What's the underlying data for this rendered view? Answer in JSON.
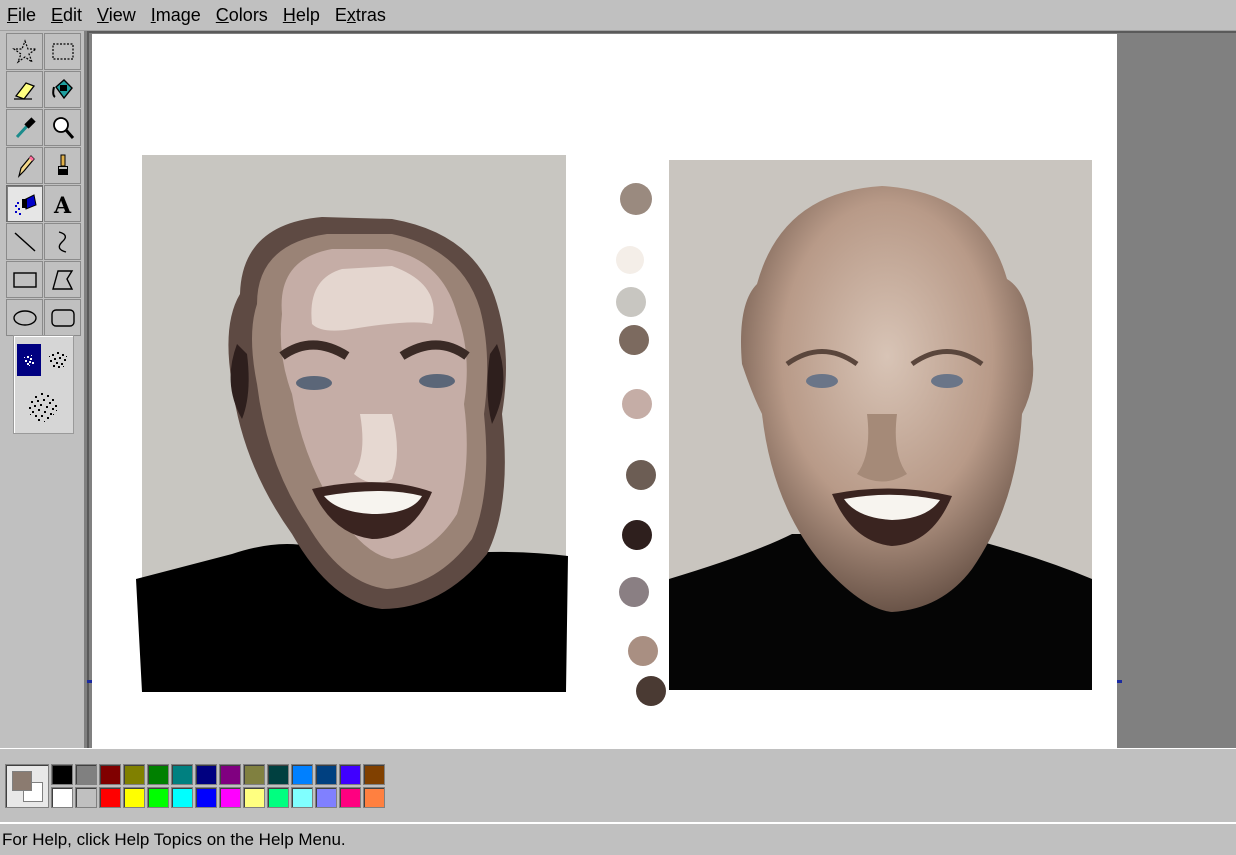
{
  "menubar": {
    "items": [
      {
        "label": "File",
        "accel": "F",
        "rest": "ile"
      },
      {
        "label": "Edit",
        "accel": "E",
        "rest": "dit"
      },
      {
        "label": "View",
        "accel": "V",
        "rest": "iew"
      },
      {
        "label": "Image",
        "accel": "I",
        "rest": "mage"
      },
      {
        "label": "Colors",
        "accel": "C",
        "rest": "olors"
      },
      {
        "label": "Help",
        "accel": "H",
        "rest": "elp"
      },
      {
        "label": "Extras",
        "accel": "x",
        "pre": "E",
        "rest": "tras"
      }
    ]
  },
  "toolbox": {
    "tools": [
      {
        "name": "free-form-select",
        "icon": "star-select-icon"
      },
      {
        "name": "rectangle-select",
        "icon": "dashed-rect-icon"
      },
      {
        "name": "eraser",
        "icon": "eraser-icon"
      },
      {
        "name": "fill-with-color",
        "icon": "paint-bucket-icon"
      },
      {
        "name": "pick-color",
        "icon": "eyedropper-icon"
      },
      {
        "name": "magnifier",
        "icon": "magnifier-icon"
      },
      {
        "name": "pencil",
        "icon": "pencil-icon"
      },
      {
        "name": "brush",
        "icon": "brush-icon"
      },
      {
        "name": "airbrush",
        "icon": "airbrush-icon",
        "selected": true
      },
      {
        "name": "text",
        "icon": "text-icon",
        "glyph": "A"
      },
      {
        "name": "line",
        "icon": "line-icon"
      },
      {
        "name": "curve",
        "icon": "curve-icon"
      },
      {
        "name": "rectangle",
        "icon": "rectangle-icon"
      },
      {
        "name": "polygon",
        "icon": "polygon-icon"
      },
      {
        "name": "ellipse",
        "icon": "ellipse-icon"
      },
      {
        "name": "rounded-rectangle",
        "icon": "rounded-rect-icon"
      }
    ],
    "airbrush_sizes": [
      "small",
      "medium",
      "large"
    ],
    "airbrush_selected": "small"
  },
  "colors": {
    "foreground": "#8b7b70",
    "background": "#ffffff",
    "palette_row1": [
      "#000000",
      "#808080",
      "#800000",
      "#808000",
      "#008000",
      "#008080",
      "#000080",
      "#800080",
      "#808040",
      "#004040",
      "#0080ff",
      "#004080",
      "#4000ff",
      "#804000"
    ],
    "palette_row2": [
      "#ffffff",
      "#c0c0c0",
      "#ff0000",
      "#ffff00",
      "#00ff00",
      "#00ffff",
      "#0000ff",
      "#ff00ff",
      "#ffff80",
      "#00ff80",
      "#80ffff",
      "#8080ff",
      "#ff0080",
      "#ff8040"
    ]
  },
  "canvas": {
    "sampled_swatches": [
      "#9a8a7f",
      "#f4eee8",
      "#c8c6c1",
      "#7c6a5f",
      "#c5ada6",
      "#6c5d54",
      "#2e1f1d",
      "#8a7f83",
      "#a98f82",
      "#4a3a33"
    ]
  },
  "status": {
    "text": "For Help, click Help Topics on the Help Menu."
  }
}
